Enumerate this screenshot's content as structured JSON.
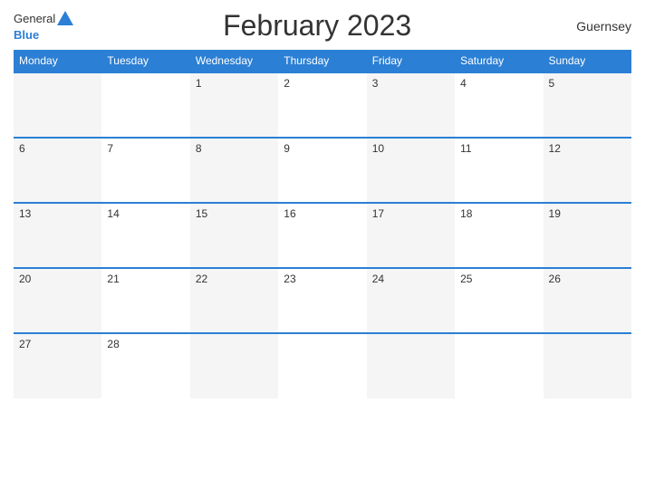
{
  "header": {
    "title": "February 2023",
    "country": "Guernsey",
    "logo": {
      "general": "General",
      "blue": "Blue"
    }
  },
  "calendar": {
    "days_of_week": [
      "Monday",
      "Tuesday",
      "Wednesday",
      "Thursday",
      "Friday",
      "Saturday",
      "Sunday"
    ],
    "weeks": [
      [
        "",
        "",
        "1",
        "2",
        "3",
        "4",
        "5"
      ],
      [
        "6",
        "7",
        "8",
        "9",
        "10",
        "11",
        "12"
      ],
      [
        "13",
        "14",
        "15",
        "16",
        "17",
        "18",
        "19"
      ],
      [
        "20",
        "21",
        "22",
        "23",
        "24",
        "25",
        "26"
      ],
      [
        "27",
        "28",
        "",
        "",
        "",
        "",
        ""
      ]
    ]
  },
  "colors": {
    "accent": "#2b7fd4",
    "header_bg": "#2b7fd4",
    "header_text": "#ffffff",
    "cell_odd": "#f5f5f5",
    "cell_even": "#ffffff"
  }
}
